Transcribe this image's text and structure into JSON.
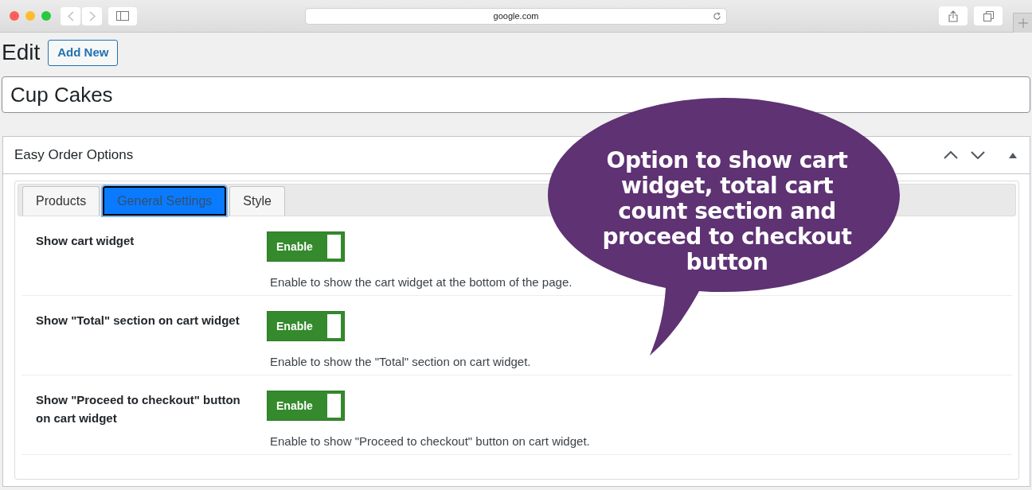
{
  "browser": {
    "address": "google.com"
  },
  "page": {
    "heading": "Edit",
    "add_new": "Add New",
    "title_value": "Cup Cakes"
  },
  "panel": {
    "title": "Easy Order Options",
    "tabs": [
      {
        "label": "Products",
        "selected": false
      },
      {
        "label": "General Settings",
        "selected": true
      },
      {
        "label": "Style",
        "selected": false
      }
    ],
    "settings": [
      {
        "label": "Show cart widget",
        "toggle": "Enable",
        "on": true,
        "description": "Enable to show the cart widget at the bottom of the page."
      },
      {
        "label": "Show \"Total\" section on cart widget",
        "toggle": "Enable",
        "on": true,
        "description": "Enable to show the \"Total\" section on cart widget."
      },
      {
        "label": "Show \"Proceed to checkout\" button on cart widget",
        "toggle": "Enable",
        "on": true,
        "description": "Enable to show \"Proceed to checkout\" button on cart widget."
      }
    ]
  },
  "callout": {
    "text": "Option to show cart widget, total cart count section and proceed to checkout button"
  }
}
